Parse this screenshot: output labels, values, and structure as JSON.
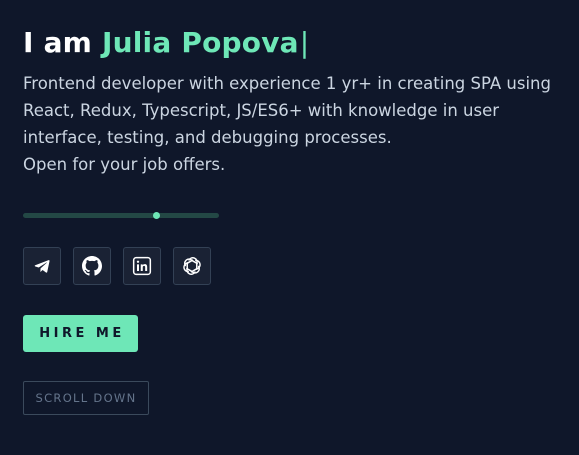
{
  "hero": {
    "greeting": "I am ",
    "name": "Julia Popova",
    "cursor": "|",
    "description_lines": [
      "Frontend developer with experience 1 yr+ in creating SPA using",
      "React, Redux, Typescript, JS/ES6+ with knowledge in user",
      "interface, testing, and debugging processes.",
      "Open for your job offers."
    ]
  },
  "slider": {
    "value_fraction": 0.68
  },
  "socials": [
    {
      "icon": "telegram-icon"
    },
    {
      "icon": "github-icon"
    },
    {
      "icon": "linkedin-icon"
    },
    {
      "icon": "openai-icon"
    }
  ],
  "buttons": {
    "hire_label": "HIRE ME",
    "scroll_label": "SCROLL DOWN"
  },
  "colors": {
    "background": "#0f172a",
    "accent": "#6ee7b7",
    "text": "#cbd5e1",
    "heading": "#ffffff"
  }
}
